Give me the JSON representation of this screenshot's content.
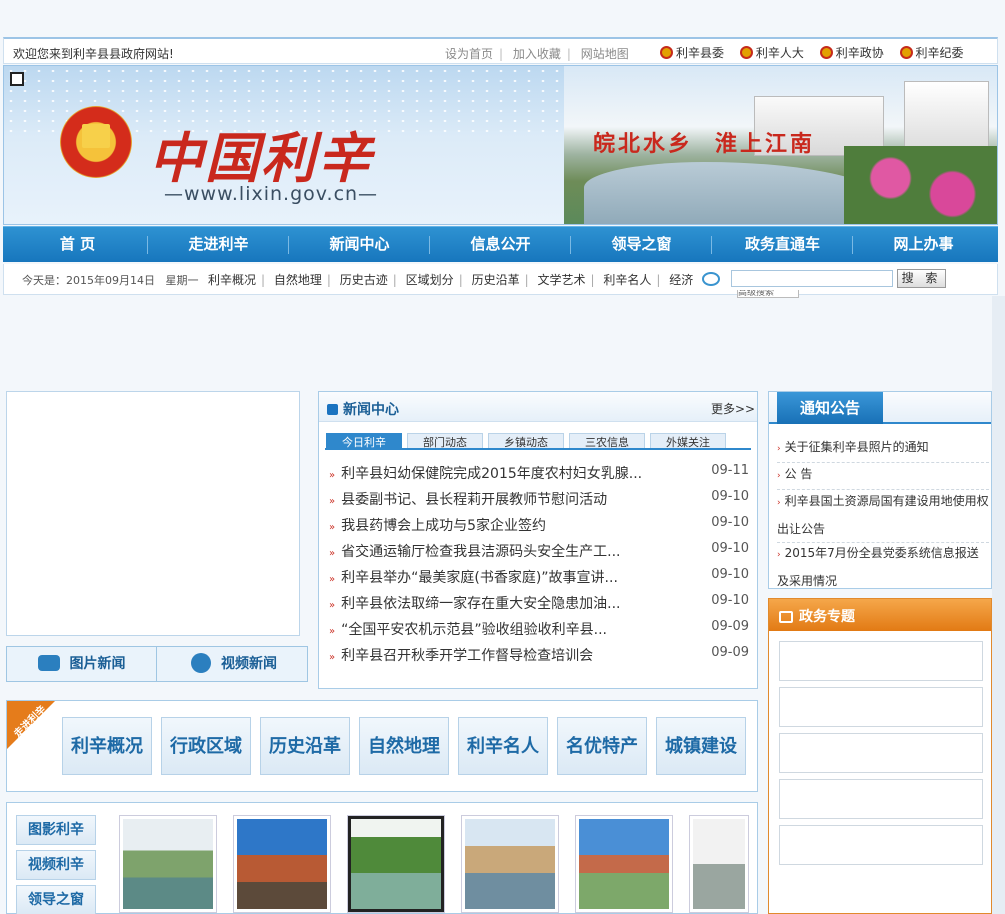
{
  "topbar": {
    "welcome": "欢迎您来到利辛县县政府网站!",
    "links": [
      "设为首页",
      "加入收藏",
      "网站地图"
    ],
    "party": [
      "利辛县委",
      "利辛人大",
      "利辛政协",
      "利辛纪委"
    ]
  },
  "banner": {
    "site_name": "中国利辛",
    "site_url": "—www.lixin.gov.cn—",
    "slogan_left": "皖北水乡",
    "slogan_right": "淮上江南"
  },
  "nav": [
    "首 页",
    "走进利辛",
    "新闻中心",
    "信息公开",
    "领导之窗",
    "政务直通车",
    "网上办事"
  ],
  "subnav": {
    "date": "今天是：2015年09月14日",
    "weekday": "星期一",
    "links": [
      "利辛概况",
      "自然地理",
      "历史古迹",
      "区域划分",
      "历史沿革",
      "文学艺术",
      "利辛名人",
      "经济"
    ],
    "search_placeholder": "",
    "search_btn": "搜 索",
    "dropdown_fragment": "高级搜索"
  },
  "media": {
    "photo_news": "图片新闻",
    "video_news": "视频新闻"
  },
  "news": {
    "title": "新闻中心",
    "more": "更多>>",
    "tabs": [
      "今日利辛",
      "部门动态",
      "乡镇动态",
      "三农信息",
      "外媒关注"
    ],
    "items": [
      {
        "title": "利辛县妇幼保健院完成2015年度农村妇女乳腺...",
        "date": "09-11"
      },
      {
        "title": "县委副书记、县长程莉开展教师节慰问活动",
        "date": "09-10"
      },
      {
        "title": "我县药博会上成功与5家企业签约",
        "date": "09-10"
      },
      {
        "title": "省交通运输厅检查我县洁源码头安全生产工...",
        "date": "09-10"
      },
      {
        "title": "利辛县举办“最美家庭(书香家庭)”故事宣讲...",
        "date": "09-10"
      },
      {
        "title": "利辛县依法取缔一家存在重大安全隐患加油...",
        "date": "09-10"
      },
      {
        "title": "“全国平安农机示范县”验收组验收利辛县...",
        "date": "09-09"
      },
      {
        "title": "利辛县召开秋季开学工作督导检查培训会",
        "date": "09-09"
      }
    ]
  },
  "notice": {
    "title": "通知公告",
    "items": [
      "关于征集利辛县照片的通知",
      "公  告",
      "利辛县国土资源局国有建设用地使用权出让公告",
      "2015年7月份全县党委系统信息报送及采用情况"
    ]
  },
  "topics": {
    "title": "政务专题"
  },
  "intro": {
    "ribbon": "走进利辛",
    "buttons": [
      "利辛概况",
      "行政区域",
      "历史沿革",
      "自然地理",
      "利辛名人",
      "名优特产",
      "城镇建设"
    ]
  },
  "gallery": {
    "tabs": [
      "图影利辛",
      "视频利辛",
      "领导之窗"
    ]
  }
}
